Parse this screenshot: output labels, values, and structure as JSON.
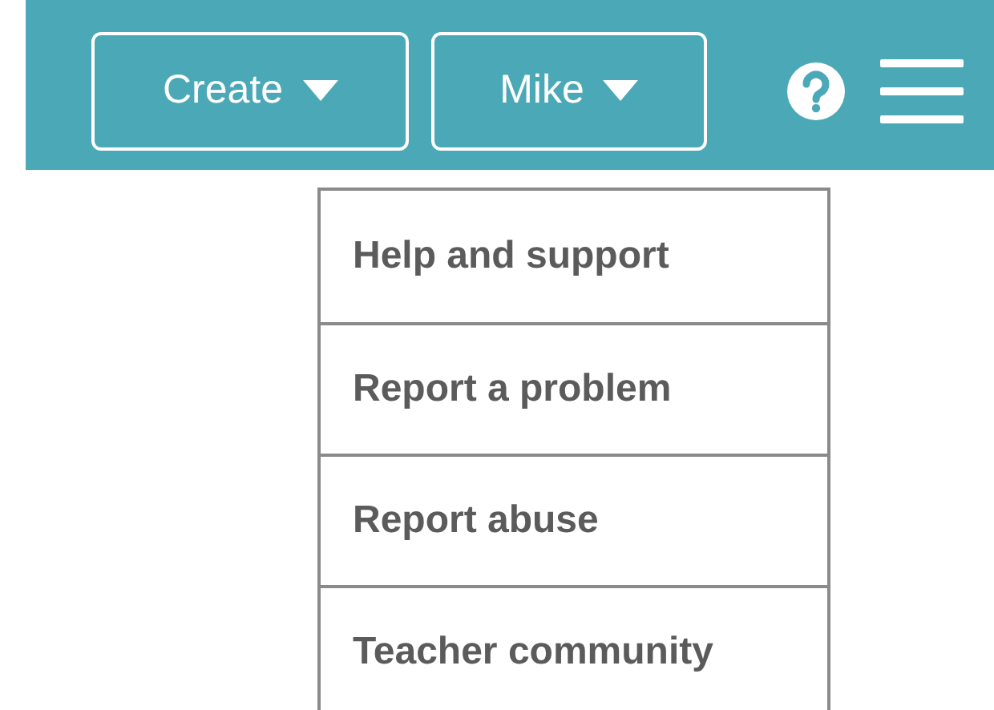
{
  "header": {
    "buttons": [
      {
        "label": "Create"
      },
      {
        "label": "Mike"
      }
    ]
  },
  "menu": {
    "items": [
      {
        "label": "Help and support"
      },
      {
        "label": "Report a problem"
      },
      {
        "label": "Report abuse"
      },
      {
        "label": "Teacher community"
      }
    ]
  }
}
